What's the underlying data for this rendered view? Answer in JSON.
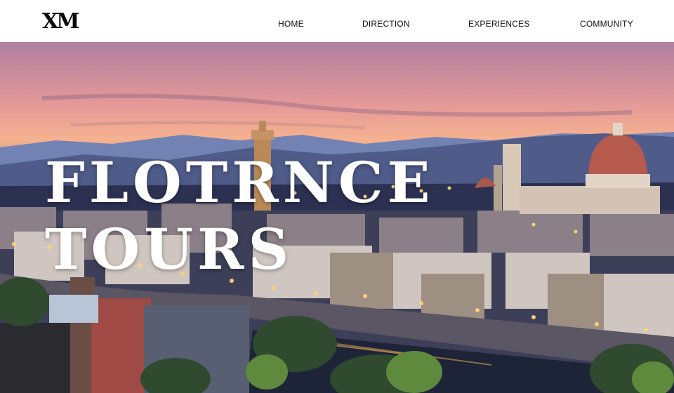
{
  "brand": {
    "logo_text": "XM"
  },
  "nav": {
    "items": [
      {
        "label": "HOME"
      },
      {
        "label": "DIRECTION"
      },
      {
        "label": "EXPERIENCES"
      },
      {
        "label": "COMMUNITY"
      }
    ]
  },
  "hero": {
    "title_line1": "FLOTRNCE",
    "title_line2": "TOURS"
  },
  "colors": {
    "nav_bg": "#ffffff",
    "nav_text": "#111111",
    "hero_title": "#ffffff"
  }
}
